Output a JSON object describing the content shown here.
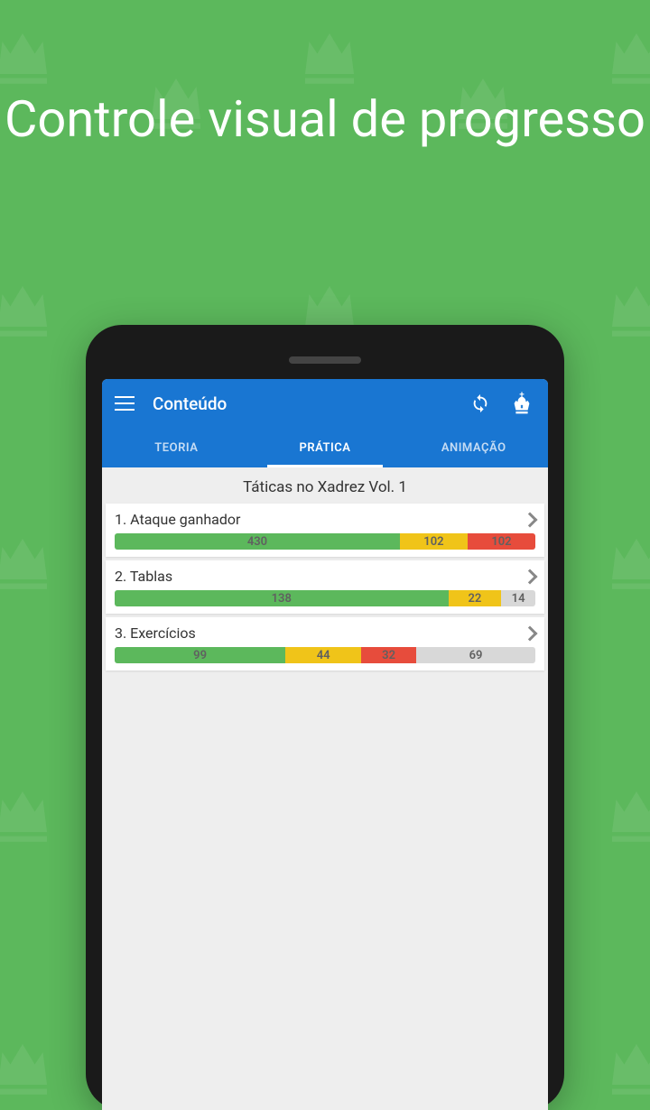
{
  "promo_title": "Controle visual de progresso",
  "appbar": {
    "title": "Conteúdo"
  },
  "tabs": [
    {
      "label": "TEORIA",
      "active": false
    },
    {
      "label": "PRÁTICA",
      "active": true
    },
    {
      "label": "ANIMAÇÃO",
      "active": false
    }
  ],
  "section_title": "Táticas no Xadrez Vol. 1",
  "lessons": [
    {
      "title": "1. Ataque ganhador",
      "segments": [
        {
          "value": 430,
          "color": "green",
          "pct": 67.8
        },
        {
          "value": 102,
          "color": "yellow",
          "pct": 16.1
        },
        {
          "value": 102,
          "color": "red",
          "pct": 16.1
        }
      ]
    },
    {
      "title": "2. Tablas",
      "segments": [
        {
          "value": 138,
          "color": "green",
          "pct": 79.3
        },
        {
          "value": 22,
          "color": "yellow",
          "pct": 12.6
        },
        {
          "value": 14,
          "color": "gray",
          "pct": 8.1
        }
      ]
    },
    {
      "title": "3. Exercícios",
      "segments": [
        {
          "value": 99,
          "color": "green",
          "pct": 40.6
        },
        {
          "value": 44,
          "color": "yellow",
          "pct": 18.0
        },
        {
          "value": 32,
          "color": "red",
          "pct": 13.1
        },
        {
          "value": 69,
          "color": "gray",
          "pct": 28.3
        }
      ]
    }
  ]
}
